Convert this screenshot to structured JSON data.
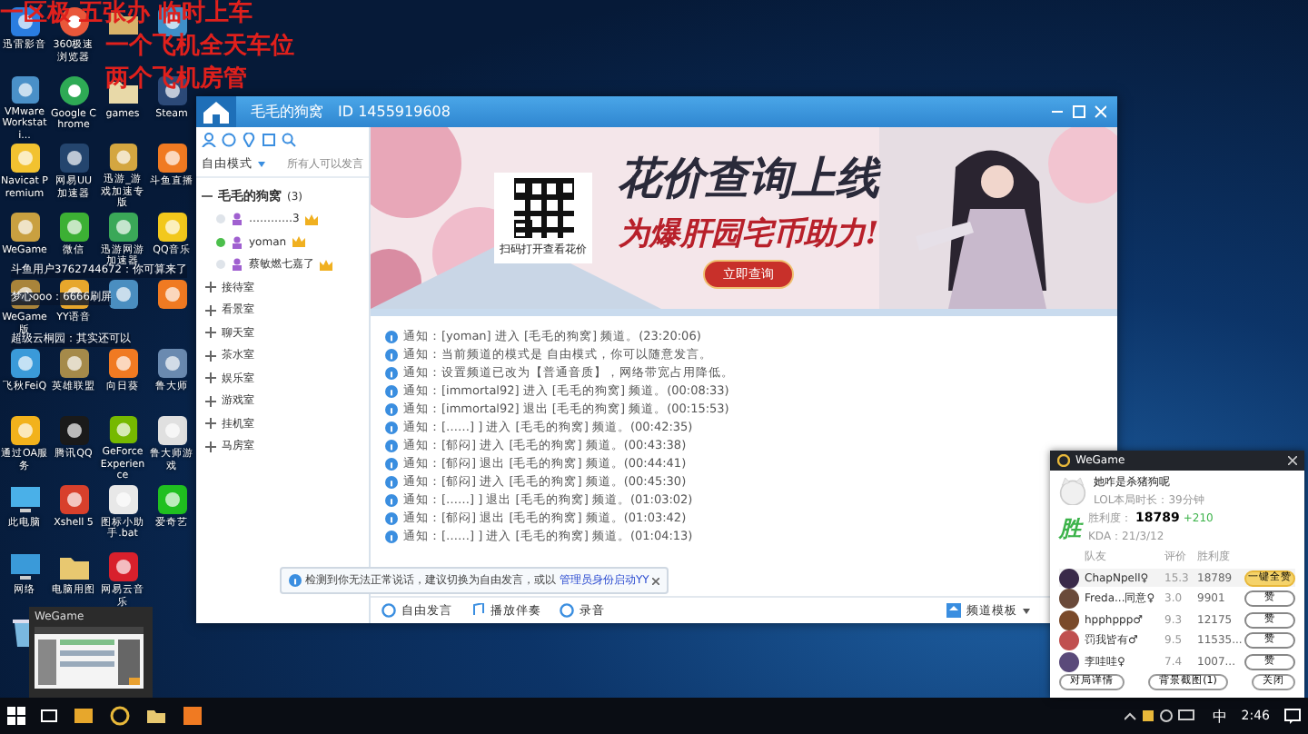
{
  "overlay": {
    "lines": [
      "一区极   五张办 临时上车",
      "一个飞机全天车位",
      "两个飞机房管"
    ]
  },
  "danmaku": [
    "斗鱼用户3762744672：你可算来了",
    "梦心ooo：6666刷屏",
    "超级云桐园：其实还可以"
  ],
  "desktop_icons": [
    [
      {
        "label": "迅雷影音",
        "kind": "app",
        "color": "#2a7de1"
      },
      {
        "label": "360极速浏览器",
        "kind": "globe",
        "color": "#e9573a"
      },
      {
        "kind": "folder",
        "color": "#d9b36a"
      },
      {
        "kind": "app",
        "color": "#3f8fc8"
      }
    ],
    [
      {
        "label": "VMware Workstati...",
        "kind": "app",
        "color": "#4a90c8"
      },
      {
        "label": "Google Chrome",
        "kind": "globe",
        "color": "#2eaa55"
      },
      {
        "label": "games",
        "kind": "folder",
        "color": "#e8d9a8"
      },
      {
        "label": "Steam",
        "kind": "app",
        "color": "#2c4a78"
      }
    ],
    [
      {
        "label": "Navicat Premium",
        "kind": "app",
        "color": "#f2c230"
      },
      {
        "label": "网易UU加速器",
        "kind": "app",
        "color": "#24456e"
      },
      {
        "label": "迅游_游戏加速专版",
        "kind": "app",
        "color": "#d4a640"
      },
      {
        "label": "斗鱼直播",
        "kind": "app",
        "color": "#f07a22"
      }
    ],
    [
      {
        "label": "WeGame",
        "kind": "app",
        "color": "#c9a040"
      },
      {
        "label": "微信",
        "kind": "app",
        "color": "#3cb034"
      },
      {
        "label": "迅游网游加速器",
        "kind": "app",
        "color": "#3aa858"
      },
      {
        "label": "QQ音乐",
        "kind": "app",
        "color": "#f2c81c"
      }
    ],
    [
      {
        "label": "WeGame版",
        "kind": "app",
        "color": "#a9843a"
      },
      {
        "label": "YY语音",
        "kind": "app",
        "color": "#e7a72c"
      },
      {
        "kind": "app",
        "color": "#4a8ec0"
      },
      {
        "kind": "app",
        "color": "#f07a22"
      }
    ],
    [
      {
        "label": "飞秋FeiQ",
        "kind": "app",
        "color": "#3a9ad9"
      },
      {
        "label": "英雄联盟",
        "kind": "app",
        "color": "#a58a4a"
      },
      {
        "label": "向日葵",
        "kind": "app",
        "color": "#f07a22"
      },
      {
        "label": "鲁大师",
        "kind": "app",
        "color": "#6a8ab0"
      }
    ],
    [
      {
        "label": "通过OA服务",
        "kind": "app",
        "color": "#f2b21c"
      },
      {
        "label": "腾讯QQ",
        "kind": "app",
        "color": "#1a1a1a"
      },
      {
        "label": "GeForce Experience",
        "kind": "app",
        "color": "#76b900"
      },
      {
        "label": "鲁大师游戏",
        "kind": "app",
        "color": "#e0e0e0"
      }
    ],
    [
      {
        "label": "此电脑",
        "kind": "monitor",
        "color": "#4ab0e8"
      },
      {
        "label": "Xshell 5",
        "kind": "app",
        "color": "#d8402c"
      },
      {
        "label": "图标小助手.bat",
        "kind": "app",
        "color": "#e8e8e8"
      },
      {
        "label": "爱奇艺",
        "kind": "app",
        "color": "#20c020"
      }
    ],
    [
      {
        "label": "网络",
        "kind": "monitor",
        "color": "#3a9ad9"
      },
      {
        "label": "电脑用图",
        "kind": "folder",
        "color": "#e8c870"
      },
      {
        "label": "网易云音乐",
        "kind": "app",
        "color": "#d8202c"
      }
    ],
    [
      {
        "kind": "trash",
        "color": "#7ab8e0"
      }
    ]
  ],
  "yy": {
    "channel_title": "毛毛的狗窝",
    "channel_id": "ID 1455919608",
    "mode": "自由模式",
    "permission": "所有人可以发言",
    "tree": {
      "name": "毛毛的狗窝",
      "count": "(3)",
      "expanded": true,
      "users": [
        {
          "name": "…………3",
          "online": false
        },
        {
          "name": "yoman",
          "online": true
        },
        {
          "name": "蔡敏燃七嘉了",
          "online": false
        }
      ],
      "children": [
        {
          "name": "接待室",
          "expanded": false
        },
        {
          "name": "看景室",
          "expanded": false
        },
        {
          "name": "聊天室",
          "expanded": false
        },
        {
          "name": "茶水室",
          "expanded": false
        },
        {
          "name": "娱乐室",
          "expanded": false
        },
        {
          "name": "游戏室",
          "expanded": false
        },
        {
          "name": "挂机室",
          "expanded": false
        },
        {
          "name": "马房室",
          "expanded": false
        }
      ]
    },
    "banner": {
      "qr_caption": "扫码打开查看花价",
      "headline": "花价查询上线",
      "subline": "为爆肝园宅币助力!",
      "button": "立即查询"
    },
    "messages": [
      {
        "text": "通知：[yoman] 进入 [毛毛的狗窝] 频道。(23:20:06)"
      },
      {
        "text": "通知：当前频道的模式是 自由模式，你可以随意发言。"
      },
      {
        "text": "通知：设置频道已改为【普通音质】，网络带宽占用降低。"
      },
      {
        "text": "通知：[immortal92] 进入 [毛毛的狗窝] 频道。(00:08:33)"
      },
      {
        "text": "通知：[immortal92] 退出 [毛毛的狗窝] 频道。(00:15:53)"
      },
      {
        "text": "通知：[……] ] 进入 [毛毛的狗窝] 频道。(00:42:35)"
      },
      {
        "text": "通知：[郁闷] 进入 [毛毛的狗窝] 频道。(00:43:38)"
      },
      {
        "text": "通知：[郁闷] 退出 [毛毛的狗窝] 频道。(00:44:41)"
      },
      {
        "text": "通知：[郁闷] 进入 [毛毛的狗窝] 频道。(00:45:30)"
      },
      {
        "text": "通知：[……] ] 退出 [毛毛的狗窝] 频道。(01:03:02)"
      },
      {
        "text": "通知：[郁闷] 退出 [毛毛的狗窝] 频道。(01:03:42)"
      },
      {
        "text": "通知：[……] ] 进入 [毛毛的狗窝] 频道。(01:04:13)"
      }
    ],
    "notice": {
      "text": "检测到你无法正常说话，建议切换为自由发言，或以",
      "link": "管理员身份启动YY"
    },
    "toolbar": [
      "自由发言",
      "播放伴奏",
      "录音"
    ],
    "template": "频道模板"
  },
  "wegame": {
    "title": "WeGame",
    "player": "她咋是杀猪狗呢",
    "duration": "LOL本局时长：39分钟",
    "result": "胜",
    "score_label": "胜利度：",
    "score": "18789",
    "delta": "+210",
    "kda": "KDA：21/3/12",
    "columns": [
      "队友",
      "评价",
      "胜利度"
    ],
    "rows": [
      {
        "name": "ChapNpell♀",
        "rating": "15.3",
        "score": "18789",
        "action": "一键全赞",
        "kind": "all"
      },
      {
        "name": "Freda...同意♀",
        "rating": "3.0",
        "score": "9901",
        "action": "赞",
        "kind": "like"
      },
      {
        "name": "hpphppp♂",
        "rating": "9.3",
        "score": "12175",
        "action": "赞",
        "kind": "like"
      },
      {
        "name": "罚我皆有♂",
        "rating": "9.5",
        "score": "11535...",
        "action": "赞",
        "kind": "like"
      },
      {
        "name": "李哇哇♀",
        "rating": "7.4",
        "score": "1007...",
        "action": "赞",
        "kind": "like"
      }
    ],
    "buttons": [
      "对局详情",
      "背景截图(1)",
      "关闭"
    ]
  },
  "preview": {
    "title": "WeGame"
  },
  "taskbar": {
    "ime": "中",
    "time": "2:46"
  }
}
